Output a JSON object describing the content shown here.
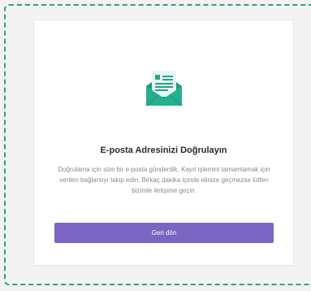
{
  "card": {
    "icon": "open-envelope-letter-icon",
    "title": "E-posta Adresinizi Doğrulayın",
    "description": "Doğrulama için size bir e-posta gönderdik. Kayıt işlemini tamamlamak için verilen bağlantıyı takip edin. Birkaç dakika içinde elinize geçmezse lütfen bizimle iletişime geçin.",
    "button_label": "Geri dön"
  },
  "colors": {
    "accent_teal": "#22a58a",
    "button_purple": "#7b65c2",
    "background": "#f3f3f3"
  }
}
